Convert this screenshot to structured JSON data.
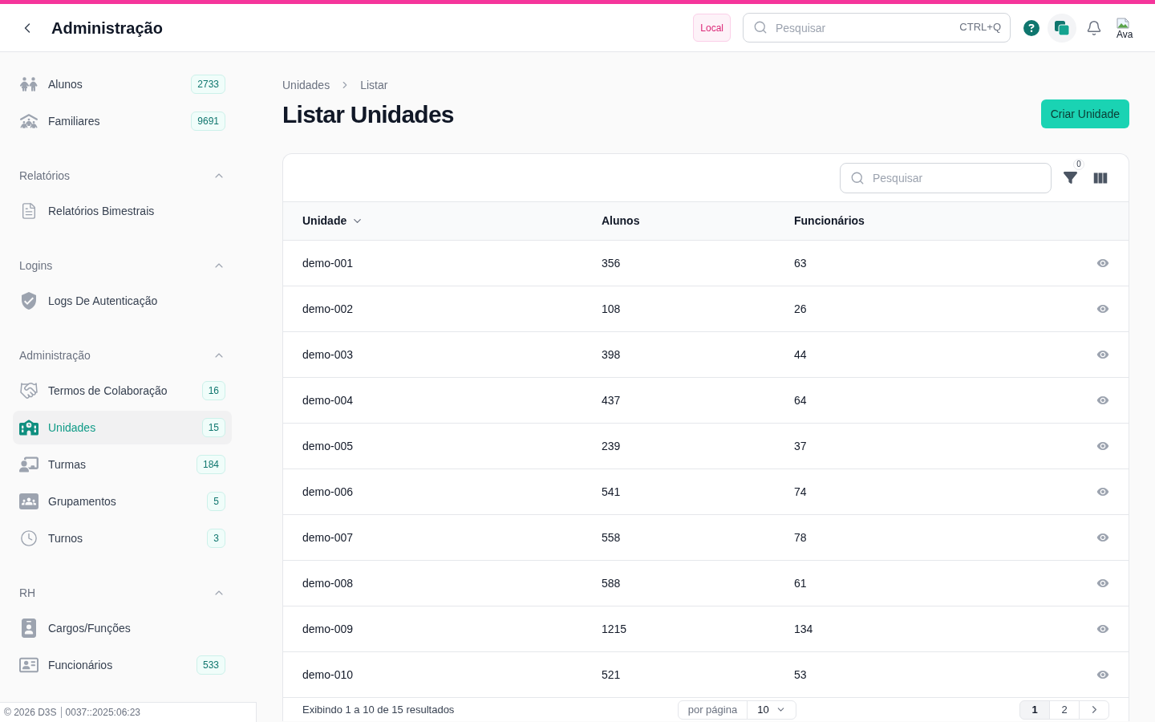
{
  "top_bar": {
    "title": "Administração",
    "environment_badge": "Local",
    "search": {
      "placeholder": "Pesquisar",
      "shortcut": "CTRL+Q"
    },
    "avatar_alt": "Ava"
  },
  "sidebar": {
    "sections": [
      {
        "items": [
          {
            "label": "Alunos",
            "count": "2733",
            "selected": false
          },
          {
            "label": "Familiares",
            "count": "9691",
            "selected": false
          }
        ]
      },
      {
        "label": "Relatórios",
        "expanded": true,
        "items": [
          {
            "label": "Relatórios Bimestrais",
            "selected": false
          }
        ]
      },
      {
        "label": "Logins",
        "expanded": true,
        "items": [
          {
            "label": "Logs De Autenticação",
            "selected": false
          }
        ]
      },
      {
        "label": "Administração",
        "expanded": true,
        "items": [
          {
            "label": "Termos de Colaboração",
            "count": "16",
            "selected": false
          },
          {
            "label": "Unidades",
            "count": "15",
            "selected": true
          },
          {
            "label": "Turmas",
            "count": "184",
            "selected": false
          },
          {
            "label": "Grupamentos",
            "count": "5",
            "selected": false
          },
          {
            "label": "Turnos",
            "count": "3",
            "selected": false
          }
        ]
      },
      {
        "label": "RH",
        "expanded": true,
        "items": [
          {
            "label": "Cargos/Funções",
            "selected": false
          },
          {
            "label": "Funcionários",
            "count": "533",
            "selected": false
          }
        ]
      }
    ],
    "footer": {
      "copyright": "© 2026 D3S",
      "build": "0037::2025:06:23"
    }
  },
  "main": {
    "breadcrumb": [
      "Unidades",
      "Listar"
    ],
    "title": "Listar Unidades",
    "create_button": "Criar Unidade",
    "table": {
      "search": {
        "placeholder": "Pesquisar"
      },
      "filter_count": "0",
      "columns": [
        {
          "label": "Unidade",
          "sorted": true
        },
        {
          "label": "Alunos",
          "sorted": false
        },
        {
          "label": "Funcionários",
          "sorted": false
        }
      ],
      "rows": [
        [
          "demo-001",
          "356",
          "63"
        ],
        [
          "demo-002",
          "108",
          "26"
        ],
        [
          "demo-003",
          "398",
          "44"
        ],
        [
          "demo-004",
          "437",
          "64"
        ],
        [
          "demo-005",
          "239",
          "37"
        ],
        [
          "demo-006",
          "541",
          "74"
        ],
        [
          "demo-007",
          "558",
          "78"
        ],
        [
          "demo-008",
          "588",
          "61"
        ],
        [
          "demo-009",
          "1215",
          "134"
        ],
        [
          "demo-010",
          "521",
          "53"
        ]
      ],
      "footer": {
        "summary": "Exibindo 1 a 10 de 15 resultados",
        "per_page_label": "por página",
        "per_page": "10",
        "pages": [
          {
            "label": "1",
            "selected": true
          },
          {
            "label": "2",
            "selected": false
          }
        ]
      }
    }
  }
}
